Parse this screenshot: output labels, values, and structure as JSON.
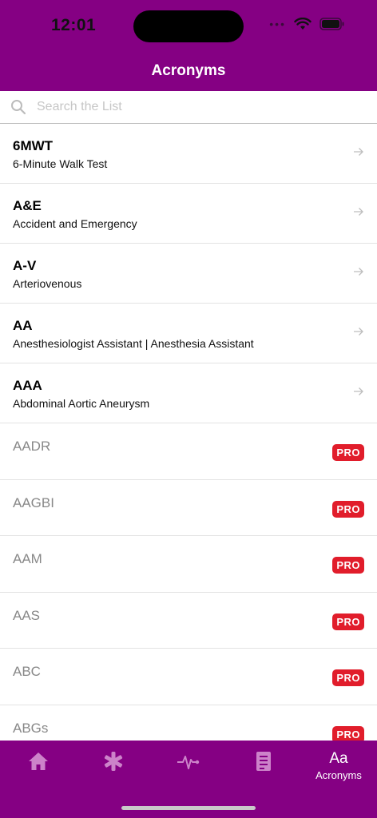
{
  "status": {
    "time": "12:01"
  },
  "header": {
    "title": "Acronyms"
  },
  "search": {
    "placeholder": "Search the List"
  },
  "acronyms": [
    {
      "abbr": "6MWT",
      "full": "6-Minute Walk Test"
    },
    {
      "abbr": "A&E",
      "full": "Accident and Emergency"
    },
    {
      "abbr": "A-V",
      "full": "Arteriovenous"
    },
    {
      "abbr": "AA",
      "full": "Anesthesiologist Assistant | Anesthesia Assistant"
    },
    {
      "abbr": "AAA",
      "full": "Abdominal Aortic Aneurysm"
    }
  ],
  "pro_acronyms": [
    {
      "abbr": "AADR",
      "badge": "PRO"
    },
    {
      "abbr": "AAGBI",
      "badge": "PRO"
    },
    {
      "abbr": "AAM",
      "badge": "PRO"
    },
    {
      "abbr": "AAS",
      "badge": "PRO"
    },
    {
      "abbr": "ABC",
      "badge": "PRO"
    },
    {
      "abbr": "ABGs",
      "badge": "PRO"
    }
  ],
  "tabbar": {
    "acronyms_glyph": "Aa",
    "acronyms_label": "Acronyms",
    "icons": [
      "home-icon",
      "asterisk-icon",
      "pulse-icon",
      "document-icon"
    ]
  },
  "colors": {
    "brand": "#850083",
    "pro_badge": "#e11d2b"
  }
}
